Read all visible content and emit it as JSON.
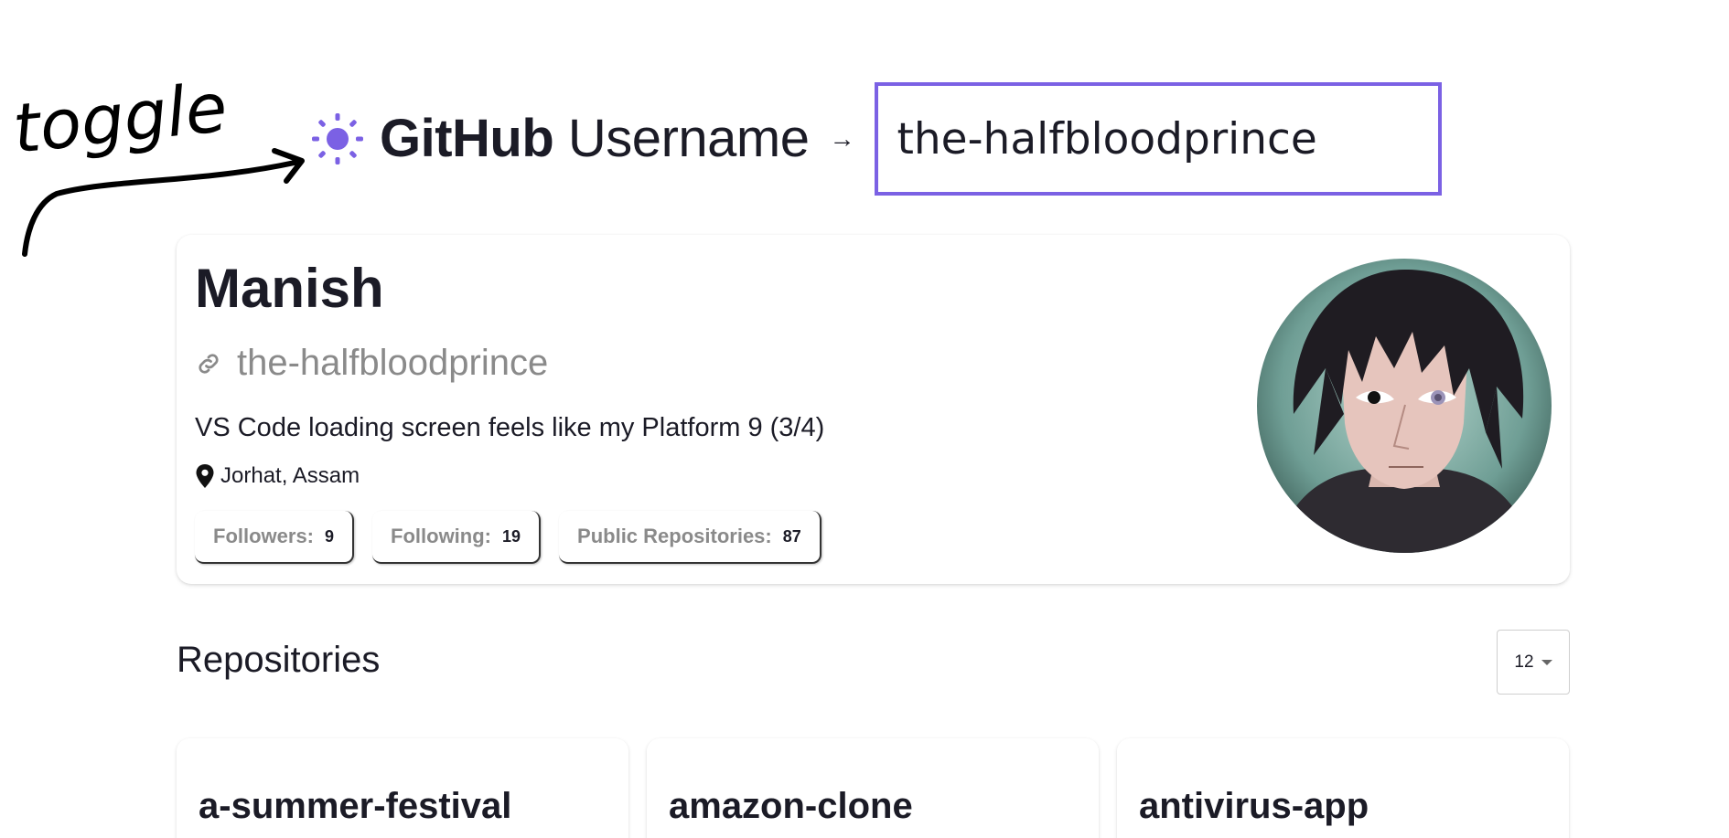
{
  "annotation": {
    "text": "toggle"
  },
  "header": {
    "brand_strong": "GitHub",
    "brand_light": "Username",
    "arrow": "→",
    "search_value": "the-halfbloodprince",
    "accent_color": "#7b61e4"
  },
  "profile": {
    "name": "Manish",
    "login": "the-halfbloodprince",
    "bio": "VS Code loading screen feels like my Platform 9 (3/4)",
    "location": "Jorhat, Assam",
    "stats": [
      {
        "label": "Followers:",
        "value": "9"
      },
      {
        "label": "Following:",
        "value": "19"
      },
      {
        "label": "Public Repositories:",
        "value": "87"
      }
    ],
    "avatar_icon": "avatar-portrait"
  },
  "repositories": {
    "title": "Repositories",
    "per_page": "12",
    "items": [
      {
        "name": "a-summer-festival"
      },
      {
        "name": "amazon-clone"
      },
      {
        "name": "antivirus-app"
      }
    ]
  }
}
